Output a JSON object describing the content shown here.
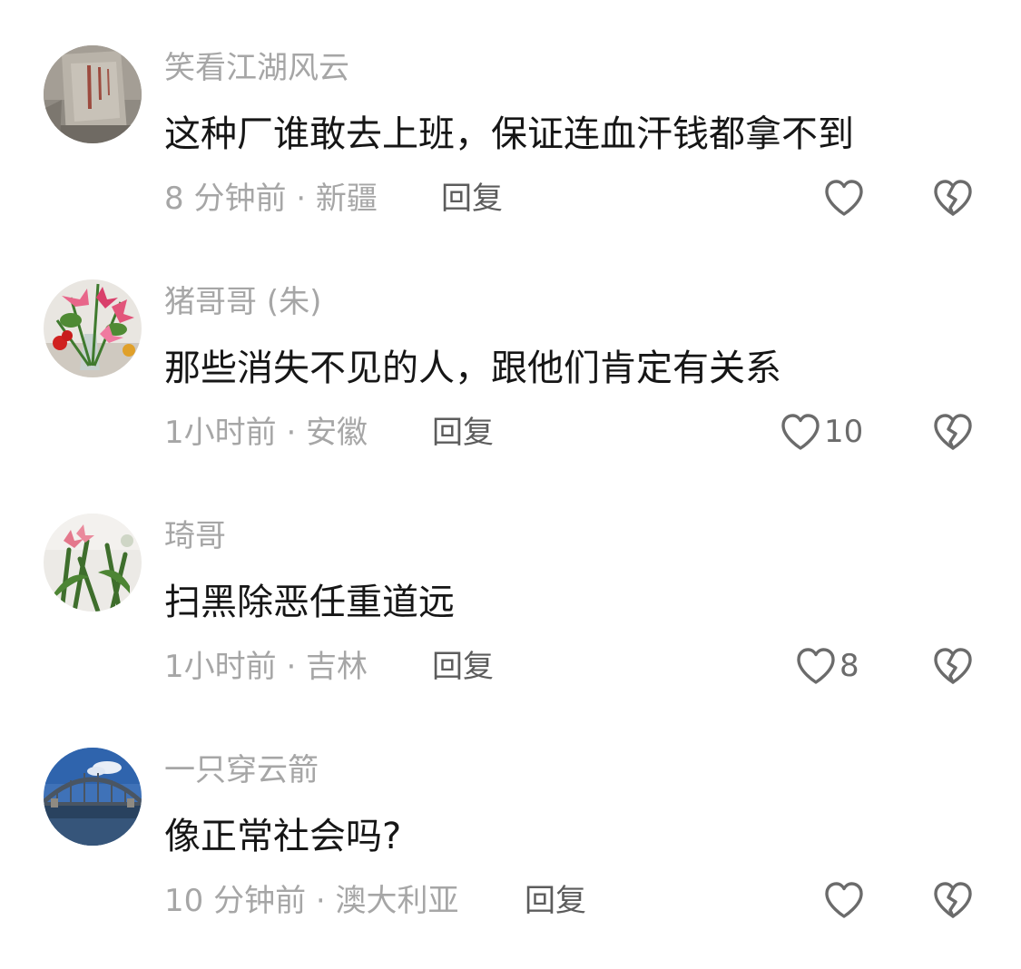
{
  "comments": [
    {
      "username": "笑看江湖风云",
      "text": "这种厂谁敢去上班，保证连血汗钱都拿不到",
      "meta": "8 分钟前 · 新疆",
      "reply_label": "回复",
      "like_count": "",
      "avatar_icon": "stone-inscription-avatar"
    },
    {
      "username": "猪哥哥 (朱)",
      "text": "那些消失不见的人，跟他们肯定有关系",
      "meta": "1小时前 · 安徽",
      "reply_label": "回复",
      "like_count": "10",
      "avatar_icon": "lily-flowers-avatar"
    },
    {
      "username": "琦哥",
      "text": "扫黑除恶任重道远",
      "meta": "1小时前 · 吉林",
      "reply_label": "回复",
      "like_count": "8",
      "avatar_icon": "orchid-plant-avatar"
    },
    {
      "username": "一只穿云箭",
      "text": "像正常社会吗?",
      "meta": "10 分钟前 · 澳大利亚",
      "reply_label": "回复",
      "like_count": "",
      "avatar_icon": "harbour-bridge-avatar"
    }
  ],
  "colors": {
    "username": "#a6a6a6",
    "text": "#161616",
    "meta": "#a6a6a6",
    "reply": "#5c5c5c",
    "icon": "#6b6b6b"
  },
  "icons": {
    "like": "heart-outline-icon",
    "dislike": "broken-heart-icon"
  }
}
